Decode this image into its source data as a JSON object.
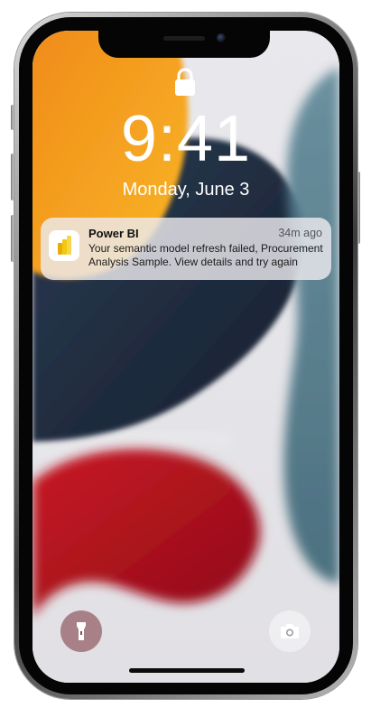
{
  "device": {
    "model_style": "iPhone frame",
    "accent_colors": {
      "wallpaper_orange": "#f6a21a",
      "wallpaper_navy": "#1f2a3c",
      "wallpaper_red": "#b8121e",
      "wallpaper_teal": "#4f7685",
      "powerbi_yellow": "#f2c811"
    }
  },
  "lock_screen": {
    "lock_icon": "lock-icon",
    "time": "9:41",
    "date": "Monday, June 3"
  },
  "notification": {
    "app_icon": "power-bi-icon",
    "app_name": "Power BI",
    "time_ago": "34m ago",
    "message": "Your semantic model refresh failed, Procurement Analysis Sample. View details and try again"
  },
  "bottom_controls": {
    "flashlight_icon": "flashlight-icon",
    "camera_icon": "camera-icon"
  }
}
